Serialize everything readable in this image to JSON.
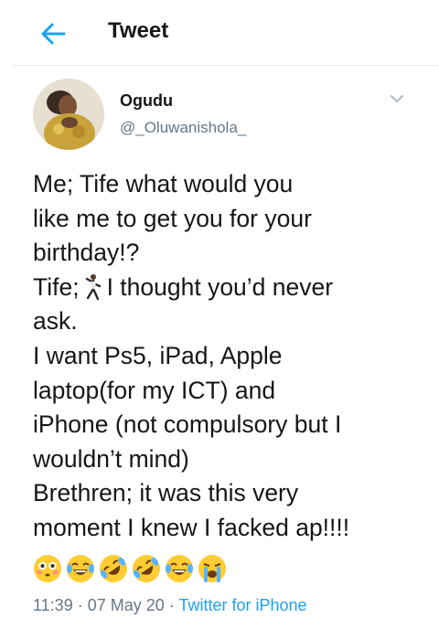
{
  "header": {
    "title": "Tweet"
  },
  "author": {
    "display_name": "Ogudu",
    "handle": "@_Oluwanishola_"
  },
  "tweet": {
    "lines": [
      "Me; Tife what would you",
      "like me to get you for your",
      "birthday!?",
      "Tife;",
      "I thought you’d never",
      "ask.",
      "I want Ps5, iPad, Apple",
      "laptop(for my ICT) and",
      "iPhone (not compulsory but I",
      "wouldn’t mind)",
      "Brethren; it was this very",
      "moment I knew I facked ap!!!!"
    ],
    "emojis": [
      "flushed-face",
      "joy-face",
      "rolling-laughing-face",
      "rolling-laughing-face",
      "joy-face",
      "crying-face"
    ]
  },
  "meta": {
    "time": "11:39",
    "sep1": " · ",
    "date": "07 May 20",
    "sep2": " · ",
    "source": "Twitter for iPhone"
  },
  "colors": {
    "accent": "#1da1f2",
    "muted": "#657786",
    "text": "#14171a"
  }
}
